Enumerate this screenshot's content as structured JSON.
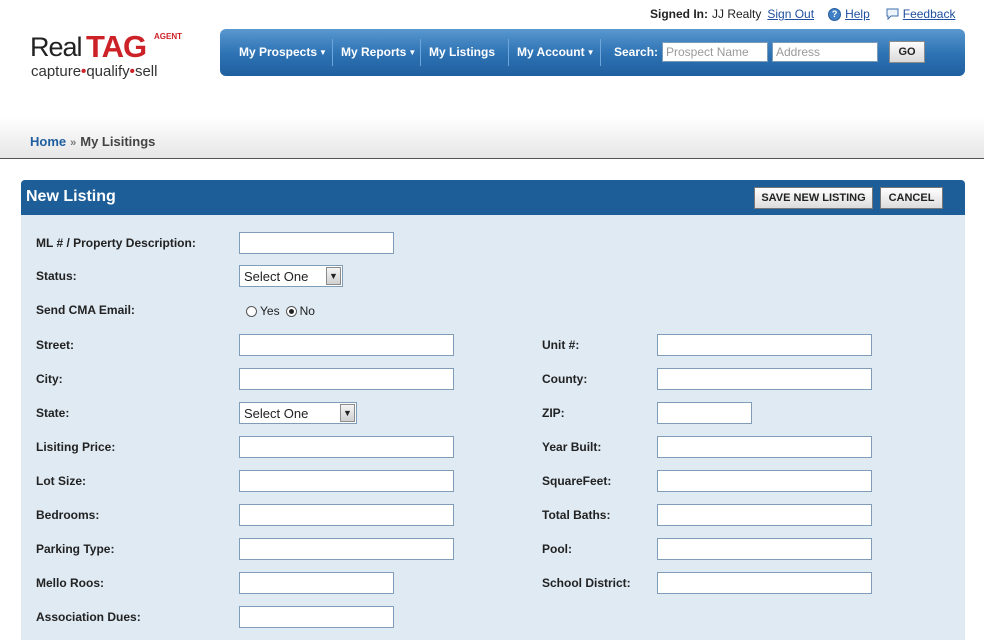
{
  "topbar": {
    "signed_in_label": "Signed In:",
    "user": "JJ Realty",
    "sign_out": "Sign Out",
    "help": "Help",
    "feedback": "Feedback"
  },
  "logo": {
    "real": "Real",
    "tag": "TAG",
    "agent": "AGENT",
    "tagline_1": "capture",
    "tagline_2": "qualify",
    "tagline_3": "sell"
  },
  "nav": {
    "items": [
      {
        "label": "My Prospects",
        "has_menu": true
      },
      {
        "label": "My Reports",
        "has_menu": true
      },
      {
        "label": "My Listings",
        "has_menu": false
      },
      {
        "label": "My Account",
        "has_menu": true
      }
    ],
    "search_label": "Search:",
    "search_name_placeholder": "Prospect Name",
    "search_address_placeholder": "Address",
    "go_label": "GO"
  },
  "breadcrumb": {
    "home": "Home",
    "separator": "»",
    "current": "My Lisitings"
  },
  "panel": {
    "title": "New Listing",
    "save_button": "SAVE NEW LISTING",
    "cancel_button": "CANCEL"
  },
  "form": {
    "ml_label": "ML # / Property Description:",
    "status_label": "Status:",
    "status_value": "Select One",
    "cma_label": "Send CMA Email:",
    "cma_yes": "Yes",
    "cma_no": "No",
    "cma_selected": "No",
    "street_label": "Street:",
    "unit_label": "Unit #:",
    "city_label": "City:",
    "county_label": "County:",
    "state_label": "State:",
    "state_value": "Select One",
    "zip_label": "ZIP:",
    "price_label": "Lisiting Price:",
    "year_label": "Year Built:",
    "lot_label": "Lot Size:",
    "sqft_label": "SquareFeet:",
    "bed_label": "Bedrooms:",
    "baths_label": "Total Baths:",
    "parking_label": "Parking Type:",
    "pool_label": "Pool:",
    "mello_label": "Mello Roos:",
    "school_label": "School District:",
    "assoc_label": "Association Dues:"
  },
  "colors": {
    "nav_blue": "#2f74b5",
    "panel_header": "#1d5d98",
    "panel_bg": "#dfeaf3",
    "brand_red": "#cc2127",
    "link_blue": "#1f4fa0"
  },
  "icons": {
    "help": "help-icon",
    "feedback": "feedback-icon",
    "dropdown": "chevron-down-icon"
  }
}
